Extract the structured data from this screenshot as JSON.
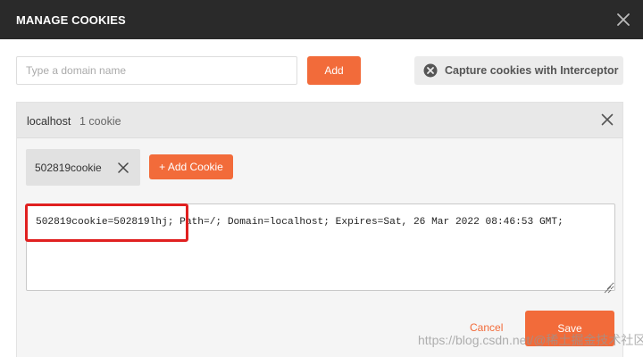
{
  "dialog": {
    "title": "MANAGE COOKIES",
    "close_icon": "close-icon"
  },
  "domain_bar": {
    "input_placeholder": "Type a domain name",
    "input_value": "",
    "add_label": "Add",
    "capture_label": "Capture cookies with Interceptor",
    "capture_icon": "interceptor-icon"
  },
  "domain_panel": {
    "domain": "localhost",
    "count": "1 cookie",
    "close_icon": "close-icon"
  },
  "cookies": {
    "chip_label": "502819cookie",
    "chip_close_icon": "close-icon",
    "add_cookie_label": "+ Add Cookie",
    "editor_value": "502819cookie=502819lhj; Path=/; Domain=localhost; Expires=Sat, 26 Mar 2022 08:46:53 GMT;"
  },
  "footer": {
    "cancel_label": "Cancel",
    "save_label": "Save"
  },
  "watermark": "https://blog.csdn.net/@稀土掘金技术社区",
  "colors": {
    "accent": "#f26b3a",
    "titlebar": "#2a2a2a",
    "highlight": "#e02020"
  }
}
